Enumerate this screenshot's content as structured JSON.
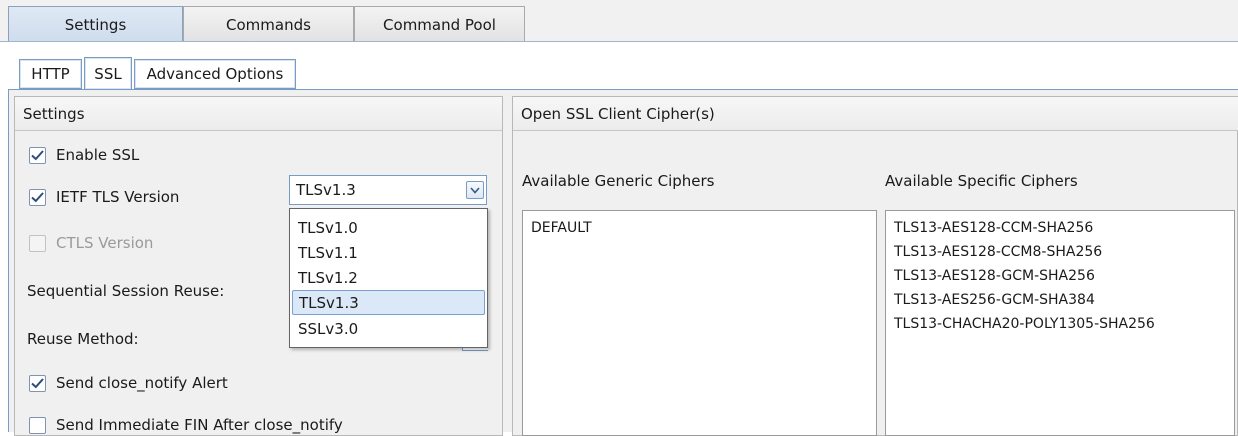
{
  "top_tabs": [
    "Settings",
    "Commands",
    "Command Pool"
  ],
  "sub_tabs": [
    "HTTP",
    "SSL",
    "Advanced Options"
  ],
  "settings_panel": {
    "title": "Settings",
    "enable_ssl": {
      "label": "Enable SSL",
      "checked": true
    },
    "ietf_tls": {
      "label": "IETF TLS Version",
      "checked": true
    },
    "ctls": {
      "label": "CTLS Version",
      "checked": false,
      "disabled": true
    },
    "sequential_reuse_label": "Sequential Session Reuse:",
    "reuse_method_label": "Reuse Method:",
    "close_notify": {
      "label": "Send close_notify Alert",
      "checked": true
    },
    "immediate_fin": {
      "label": "Send Immediate FIN After close_notify",
      "checked": false
    },
    "tls_combo": {
      "selected": "TLSv1.3",
      "options": [
        "TLSv1.0",
        "TLSv1.1",
        "TLSv1.2",
        "TLSv1.3",
        "SSLv3.0"
      ],
      "highlighted": "TLSv1.3"
    }
  },
  "cipher_panel": {
    "title": "Open SSL Client Cipher(s)",
    "generic_label": "Available Generic Ciphers",
    "specific_label": "Available Specific Ciphers",
    "generic": [
      "DEFAULT"
    ],
    "specific": [
      "TLS13-AES128-CCM-SHA256",
      "TLS13-AES128-CCM8-SHA256",
      "TLS13-AES128-GCM-SHA256",
      "TLS13-AES256-GCM-SHA384",
      "TLS13-CHACHA20-POLY1305-SHA256"
    ]
  },
  "colors": {
    "accent_border": "#7a9cc4",
    "check": "#2b4d7a",
    "selected_bg": "#dbe8f7"
  }
}
